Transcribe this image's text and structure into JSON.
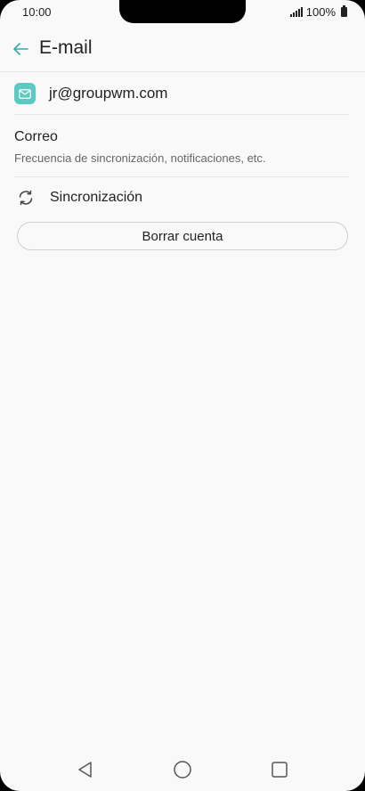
{
  "status_bar": {
    "time": "10:00",
    "battery": "100%"
  },
  "app_bar": {
    "title": "E-mail"
  },
  "account": {
    "email": "jr@groupwm.com"
  },
  "settings": {
    "correo_title": "Correo",
    "correo_subtitle": "Frecuencia de sincronización, notificaciones, etc.",
    "sync_label": "Sincronización"
  },
  "actions": {
    "delete_account_label": "Borrar cuenta"
  },
  "colors": {
    "accent": "#2bb0aa",
    "mail_icon_bg": "#5cc9c3",
    "background": "#f9f9f9"
  },
  "icons": {
    "back": "arrow-left-icon",
    "mail": "mail-icon",
    "sync": "sync-icon",
    "nav_back": "triangle-back-icon",
    "nav_home": "circle-home-icon",
    "nav_recent": "square-recent-icon"
  }
}
